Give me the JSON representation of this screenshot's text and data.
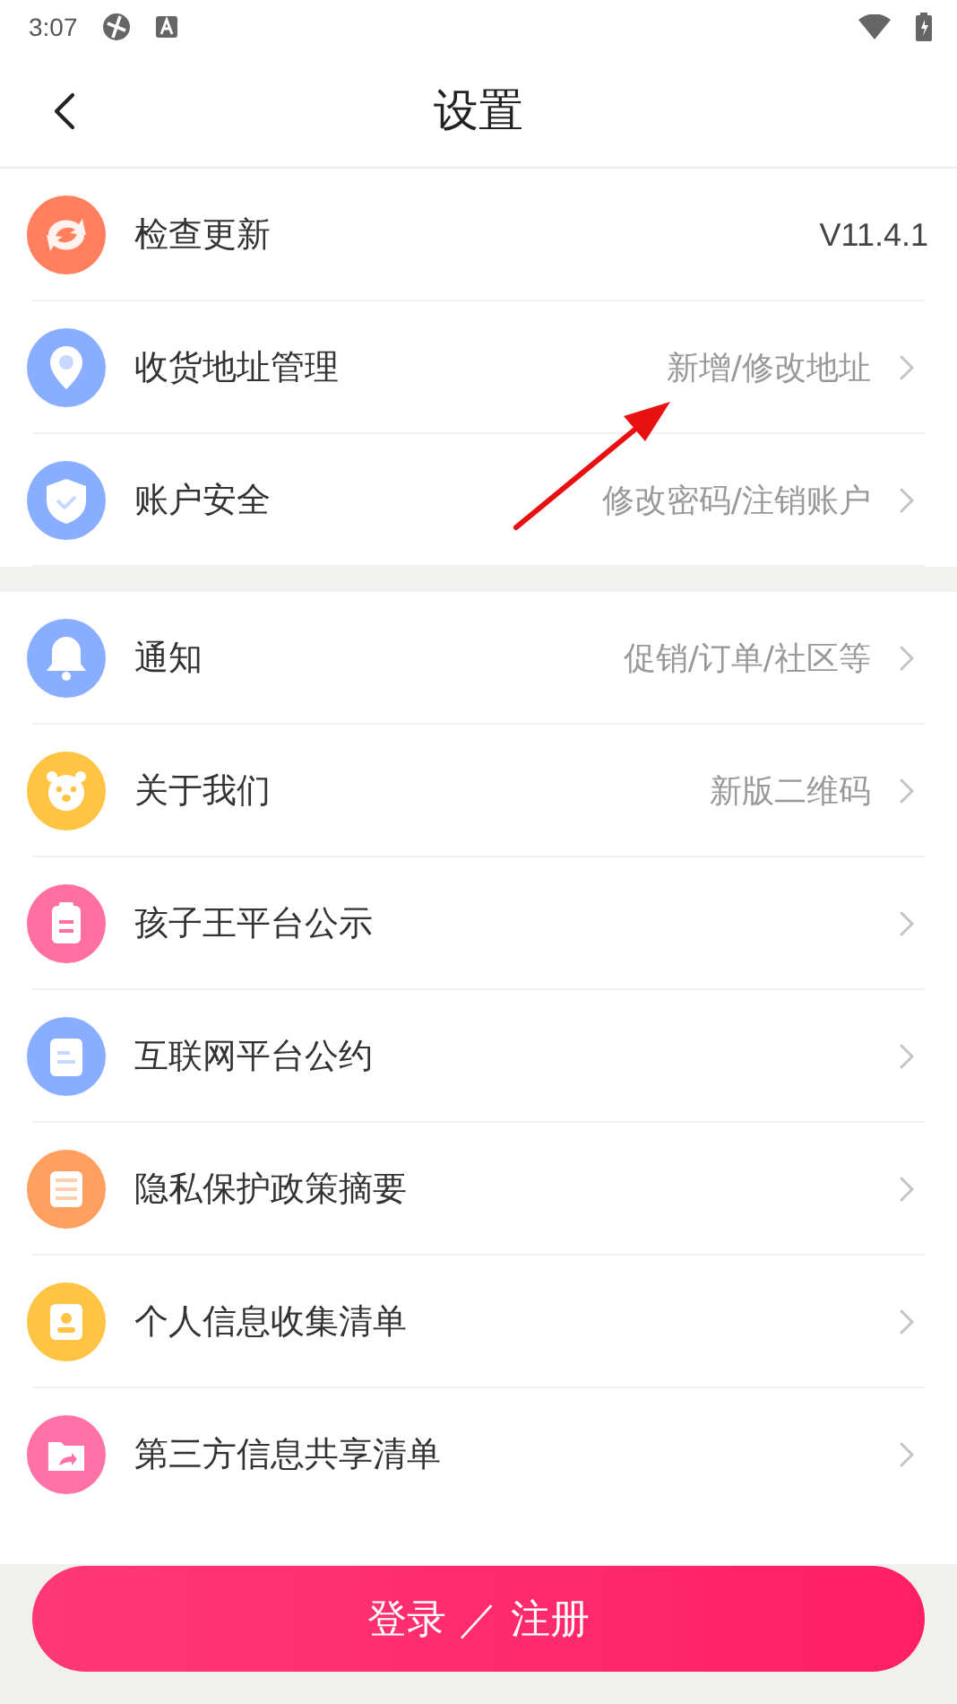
{
  "status_bar": {
    "time": "3:07"
  },
  "header": {
    "title": "设置"
  },
  "groups": [
    [
      {
        "label": "检查更新",
        "value": "V11.4.1",
        "chevron": false,
        "color": "#ff7f5e"
      },
      {
        "label": "收货地址管理",
        "value": "新增/修改地址",
        "chevron": true,
        "color": "#8aaeff"
      },
      {
        "label": "账户安全",
        "value": "修改密码/注销账户",
        "chevron": true,
        "color": "#8aaeff"
      }
    ],
    [
      {
        "label": "通知",
        "value": "促销/订单/社区等",
        "chevron": true,
        "color": "#8aaeff"
      },
      {
        "label": "关于我们",
        "value": "新版二维码",
        "chevron": true,
        "color": "#ffc444"
      },
      {
        "label": "孩子王平台公示",
        "chevron": true,
        "color": "#ff6fa2"
      },
      {
        "label": "互联网平台公约",
        "chevron": true,
        "color": "#8aaeff"
      },
      {
        "label": "隐私保护政策摘要",
        "chevron": true,
        "color": "#ffa060"
      },
      {
        "label": "个人信息收集清单",
        "chevron": true,
        "color": "#ffc444"
      },
      {
        "label": "第三方信息共享清单",
        "chevron": true,
        "color": "#ff72a8"
      }
    ]
  ],
  "login_button": {
    "label": "登录 ／ 注册"
  }
}
